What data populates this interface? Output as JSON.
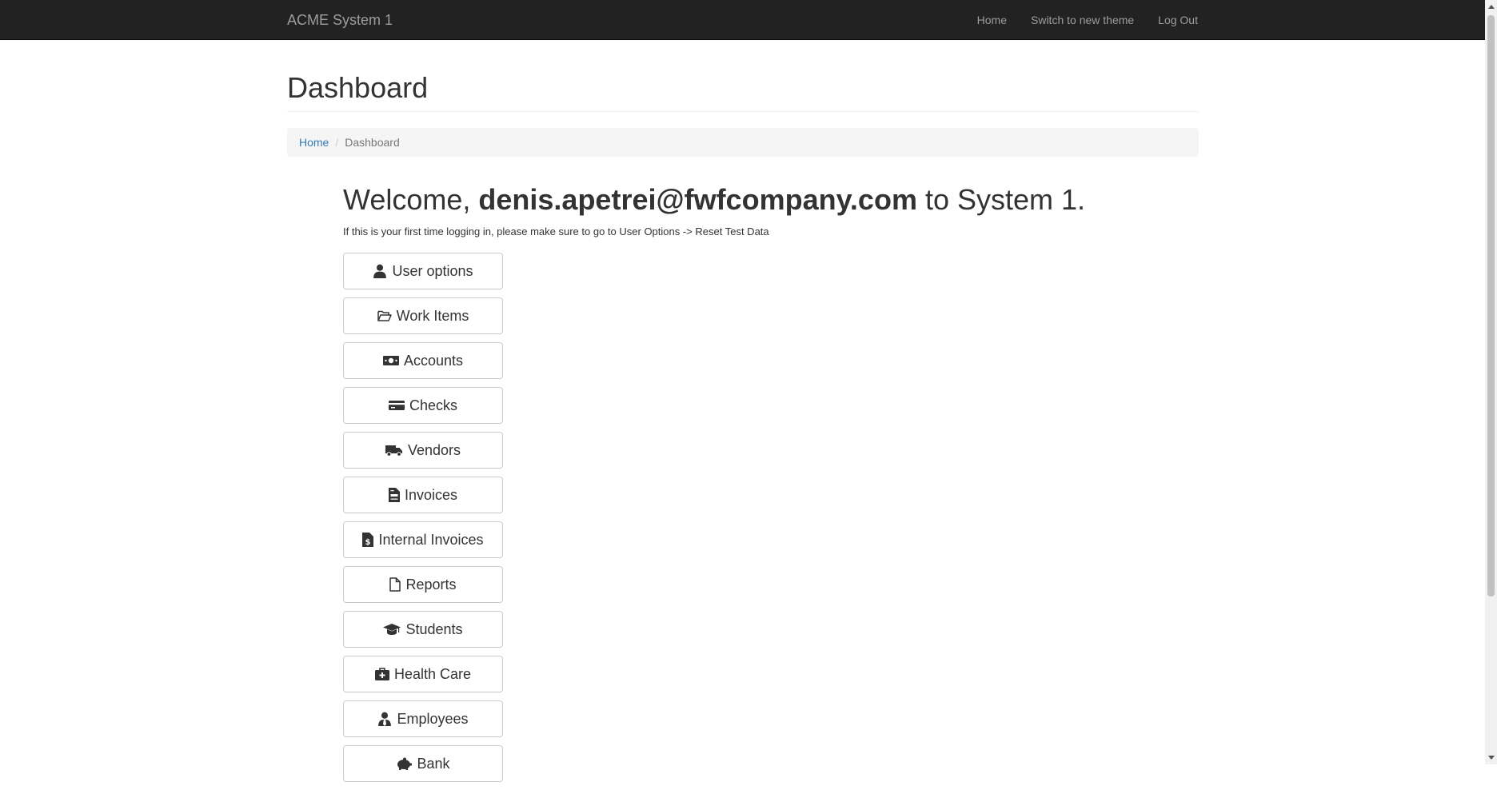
{
  "navbar": {
    "brand": "ACME System 1",
    "links": [
      {
        "label": "Home"
      },
      {
        "label": "Switch to new theme"
      },
      {
        "label": "Log Out"
      }
    ]
  },
  "page": {
    "title": "Dashboard"
  },
  "breadcrumb": {
    "home": "Home",
    "current": "Dashboard"
  },
  "welcome": {
    "prefix": "Welcome, ",
    "user": "denis.apetrei@fwfcompany.com",
    "suffix": " to System 1.",
    "note": "If this is your first time logging in, please make sure to go to User Options -> Reset Test Data"
  },
  "menu": [
    {
      "label": "User options",
      "icon": "user-icon"
    },
    {
      "label": "Work Items",
      "icon": "folder-open-icon"
    },
    {
      "label": "Accounts",
      "icon": "money-bill-icon"
    },
    {
      "label": "Checks",
      "icon": "credit-card-icon"
    },
    {
      "label": "Vendors",
      "icon": "truck-icon"
    },
    {
      "label": "Invoices",
      "icon": "file-invoice-icon"
    },
    {
      "label": "Internal Invoices",
      "icon": "file-invoice-dollar-icon"
    },
    {
      "label": "Reports",
      "icon": "file-icon"
    },
    {
      "label": "Students",
      "icon": "graduation-cap-icon"
    },
    {
      "label": "Health Care",
      "icon": "medkit-icon"
    },
    {
      "label": "Employees",
      "icon": "user-tie-icon"
    },
    {
      "label": "Bank",
      "icon": "piggy-bank-icon"
    }
  ]
}
